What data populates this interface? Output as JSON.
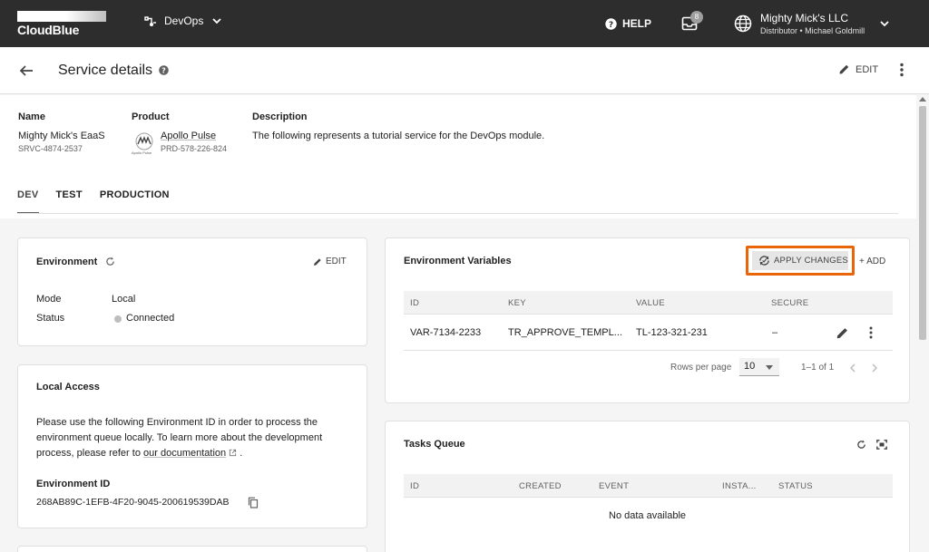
{
  "app": {
    "brand": "CloudBlue",
    "module": "DevOps",
    "help_label": "HELP",
    "inbox_count": "8",
    "account_name": "Mighty Mick's LLC",
    "account_sub": "Distributor • Michael Goldmill"
  },
  "header": {
    "title": "Service details",
    "edit_label": "EDIT"
  },
  "details": {
    "name_label": "Name",
    "name_value": "Mighty Mick's EaaS",
    "name_id": "SRVC-4874-2537",
    "product_label": "Product",
    "product_value": "Apollo Pulse",
    "product_id": "PRD-578-226-824",
    "product_logo_caption": "Apollo Pulse",
    "description_label": "Description",
    "description_value": "The following represents a tutorial service for the DevOps module."
  },
  "tabs": [
    {
      "label": "DEV"
    },
    {
      "label": "TEST"
    },
    {
      "label": "PRODUCTION"
    }
  ],
  "environment": {
    "title": "Environment",
    "edit_label": "EDIT",
    "mode_label": "Mode",
    "mode_value": "Local",
    "status_label": "Status",
    "status_value": "Connected"
  },
  "local_access": {
    "title": "Local Access",
    "text_1": "Please use the following Environment ID in order to process the",
    "text_2": "environment queue locally. To learn more about the development",
    "text_3": "process, please refer to",
    "link": "our documentation",
    "text_end": ".",
    "env_id_label": "Environment ID",
    "env_id_value": "268AB89C-1EFB-4F20-9045-200619539DAB"
  },
  "env_vars": {
    "title": "Environment Variables",
    "apply_label": "APPLY CHANGES",
    "add_label": "+ ADD",
    "columns": [
      "ID",
      "KEY",
      "VALUE",
      "SECURE"
    ],
    "rows": [
      {
        "id": "VAR-7134-2233",
        "key": "TR_APPROVE_TEMPL...",
        "value": "TL-123-321-231",
        "secure": "–"
      }
    ],
    "rows_per_page_label": "Rows per page",
    "rows_per_page": "10",
    "range": "1–1 of 1"
  },
  "tasks": {
    "title": "Tasks Queue",
    "columns": [
      "ID",
      "CREATED",
      "EVENT",
      "INSTA...",
      "STATUS"
    ],
    "empty": "No data available"
  },
  "colors": {
    "topbar": "#2d2d2d",
    "highlight": "#e8650a"
  }
}
